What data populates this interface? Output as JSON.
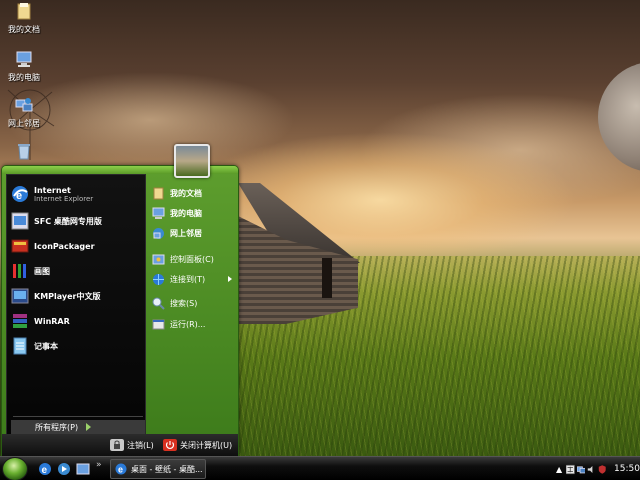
{
  "desktop": {
    "icons": [
      {
        "label": "我的文档",
        "icon": "folder-icon"
      },
      {
        "label": "我的电脑",
        "icon": "computer-icon"
      },
      {
        "label": "网上邻居",
        "icon": "network-icon"
      },
      {
        "label": "",
        "icon": "recycle-bin-icon"
      }
    ]
  },
  "start_menu": {
    "pinned": {
      "internet_title": "Internet",
      "internet_sub": "Internet Explorer"
    },
    "programs": [
      {
        "label": "SFC 桌酷网专用版",
        "icon": "sfc-icon"
      },
      {
        "label": "IconPackager",
        "icon": "iconpackager-icon"
      },
      {
        "label": "画图",
        "icon": "paint-icon"
      },
      {
        "label": "KMPlayer中文版",
        "icon": "kmplayer-icon"
      },
      {
        "label": "WinRAR",
        "icon": "winrar-icon"
      },
      {
        "label": "记事本",
        "icon": "notepad-icon"
      }
    ],
    "all_programs_label": "所有程序(P)",
    "places": [
      {
        "label": "我的文档",
        "icon": "documents-icon",
        "bold": true
      },
      {
        "label": "我的电脑",
        "icon": "computer-icon",
        "bold": true
      },
      {
        "label": "网上邻居",
        "icon": "network-icon",
        "bold": true
      },
      {
        "label": "控制面板(C)",
        "icon": "control-panel-icon",
        "bold": false
      },
      {
        "label": "连接到(T)",
        "icon": "connect-icon",
        "bold": false
      },
      {
        "label": "搜索(S)",
        "icon": "search-icon",
        "bold": false
      },
      {
        "label": "运行(R)...",
        "icon": "run-icon",
        "bold": false
      }
    ],
    "logoff_label": "注销(L)",
    "shutdown_label": "关闭计算机(U)"
  },
  "taskbar": {
    "quicklaunch_more": "»",
    "task_button_label": "桌面 - 壁纸 - 桌酷...",
    "tray_arrow": "▲",
    "clock": "15:50"
  },
  "colors": {
    "start_menu_green": "#3c7a1a",
    "left_panel_black": "#0a0a0a",
    "taskbar_black": "#0e0e0e"
  }
}
